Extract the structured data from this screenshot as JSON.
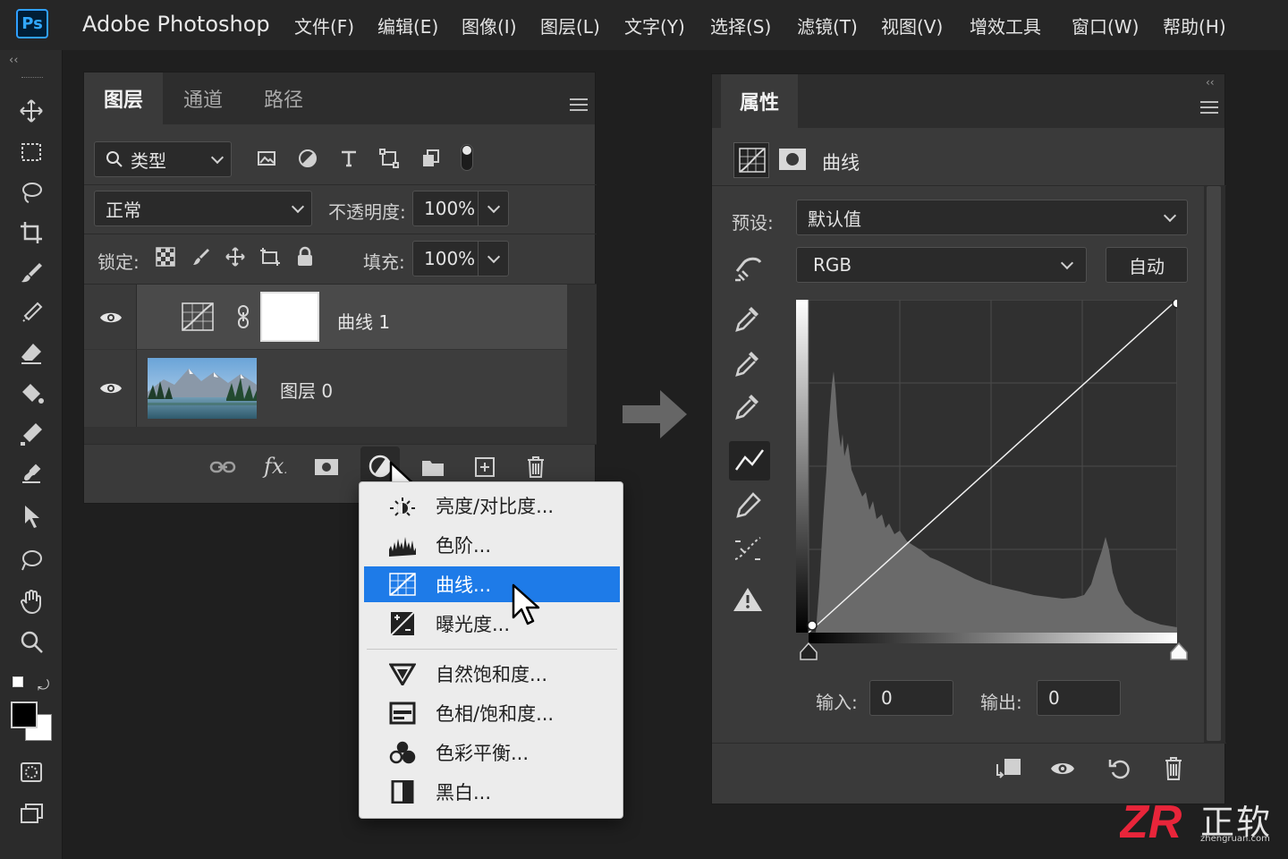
{
  "app": {
    "logo_text": "Ps",
    "name": "Adobe Photoshop"
  },
  "menubar": [
    "文件(F)",
    "编辑(E)",
    "图像(I)",
    "图层(L)",
    "文字(Y)",
    "选择(S)",
    "滤镜(T)",
    "视图(V)",
    "增效工具",
    "窗口(W)",
    "帮助(H)"
  ],
  "toolbar": {
    "collapse_glyph": "‹‹",
    "tools": [
      "move-tool-icon",
      "marquee-tool-icon",
      "lasso-tool-icon",
      "crop-tool-icon",
      "brush-tool-icon",
      "healing-brush-tool-icon",
      "eraser-tool-icon",
      "paint-bucket-tool-icon",
      "gradient-tool-icon",
      "stamp-tool-icon",
      "path-selection-tool-icon",
      "lasso-selection-icon",
      "hand-tool-icon",
      "zoom-tool-icon",
      "quick-mask-icon",
      "screen-mode-icon"
    ]
  },
  "layers_panel": {
    "tabs": [
      "图层",
      "通道",
      "路径"
    ],
    "active_tab": "图层",
    "filter": {
      "label": "类型"
    },
    "blend_mode": "正常",
    "opacity": {
      "label": "不透明度:",
      "value": "100%"
    },
    "lock": {
      "label": "锁定:"
    },
    "fill": {
      "label": "填充:",
      "value": "100%"
    },
    "layers": [
      {
        "name": "曲线 1",
        "type": "curves-adjustment",
        "visible": true,
        "selected": true
      },
      {
        "name": "图层 0",
        "type": "image",
        "visible": true,
        "selected": false
      }
    ],
    "footer_icons": [
      "link-icon",
      "fx-icon",
      "mask-icon",
      "adjustment-icon",
      "group-icon",
      "new-layer-icon",
      "trash-icon"
    ],
    "fx_label": "fx"
  },
  "adjustment_menu": {
    "items": [
      {
        "label": "亮度/对比度...",
        "icon": "brightness-icon"
      },
      {
        "label": "色阶...",
        "icon": "levels-icon"
      },
      {
        "label": "曲线...",
        "icon": "curves-icon",
        "selected": true
      },
      {
        "label": "曝光度...",
        "icon": "exposure-icon"
      },
      {
        "label": "自然饱和度...",
        "icon": "vibrance-icon"
      },
      {
        "label": "色相/饱和度...",
        "icon": "hue-saturation-icon"
      },
      {
        "label": "色彩平衡...",
        "icon": "color-balance-icon"
      },
      {
        "label": "黑白...",
        "icon": "black-white-icon"
      }
    ]
  },
  "properties_panel": {
    "tab": "属性",
    "adjustment_title": "曲线",
    "preset": {
      "label": "预设:",
      "value": "默认值"
    },
    "channel": "RGB",
    "auto_label": "自动",
    "input": {
      "label": "输入:",
      "value": "0"
    },
    "output": {
      "label": "输出:",
      "value": "0"
    },
    "footer_icons": [
      "clip-to-layer-icon",
      "visibility-icon",
      "reset-icon",
      "trash-icon"
    ],
    "curve_points": [
      [
        0,
        0
      ],
      [
        255,
        255
      ]
    ]
  },
  "watermark": {
    "brand": "ZR",
    "text": "正软",
    "url": "zhengruan.com"
  },
  "colors": {
    "accent": "#1e7be8",
    "ps_blue": "#31a8ff",
    "watermark_red": "#e8253a"
  }
}
